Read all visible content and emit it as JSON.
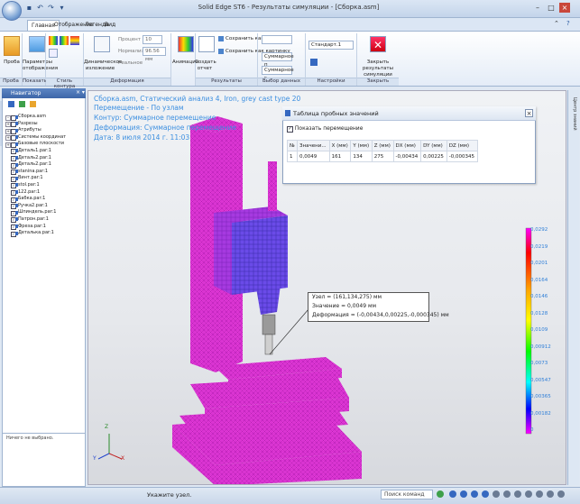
{
  "titlebar": {
    "title": "Solid Edge ST6 - Результаты симуляции - [Сборка.asm]",
    "help": "?"
  },
  "tabs": [
    {
      "label": "Главная",
      "active": true
    },
    {
      "label": "Отображение",
      "active": false
    },
    {
      "label": "Легенда",
      "active": false
    },
    {
      "label": "Вид",
      "active": false
    }
  ],
  "ribbon": {
    "proba": "Проба",
    "params": "Параметры отображения",
    "dynamic": "Динамическое изложение",
    "percent_label": "Процент",
    "percent_value": "10",
    "normalize_label": "Нормализовать",
    "normalize_value": "96.56 мм",
    "real_label": "Реальное",
    "animation": "Анимация",
    "create_report": "Создать отчет",
    "save_as_video": "Сохранить как видео",
    "save_as_image": "Сохранить как картинку",
    "data_select": "Суммарное п",
    "data_select2": "Суммарное г",
    "standard_select": "Стандарт.1",
    "close_results": "Закрыть результаты симуляции",
    "groups": {
      "proba": "Проба",
      "show": "Показать",
      "contour_style": "Стиль контура",
      "deformation": "Деформация",
      "results": "Результаты",
      "data_select": "Выбор данных",
      "settings": "Настройки",
      "close": "Закрыть"
    }
  },
  "navigator": {
    "title": "Навигатор",
    "items": [
      {
        "label": "Сборка.asm",
        "check": "",
        "exp": "–"
      },
      {
        "label": "Разрезы",
        "check": "",
        "exp": "+"
      },
      {
        "label": "Атрибуты",
        "check": "",
        "exp": "+"
      },
      {
        "label": "Системы координат",
        "check": "",
        "exp": "+"
      },
      {
        "label": "Базовые плоскости",
        "check": "",
        "exp": "+"
      },
      {
        "label": "Деталь1.par:1",
        "check": "✓",
        "exp": ""
      },
      {
        "label": "Деталь2.par:1",
        "check": "✓",
        "exp": ""
      },
      {
        "label": "Деталь2.par:1",
        "check": "✓",
        "exp": ""
      },
      {
        "label": "stanina.par:1",
        "check": "✓",
        "exp": ""
      },
      {
        "label": "Винт.par:1",
        "check": "✓",
        "exp": ""
      },
      {
        "label": "stol.par:1",
        "check": "✓",
        "exp": ""
      },
      {
        "label": "122.par:1",
        "check": "✓",
        "exp": ""
      },
      {
        "label": "Бабка.par:1",
        "check": "✓",
        "exp": ""
      },
      {
        "label": "Ручка2.par:1",
        "check": "✓",
        "exp": ""
      },
      {
        "label": "Шпиндель.par:1",
        "check": "✓",
        "exp": ""
      },
      {
        "label": "Патрон.par:1",
        "check": "✓",
        "exp": ""
      },
      {
        "label": "Фреза.par:1",
        "check": "✓",
        "exp": ""
      },
      {
        "label": "Деталька.par:1",
        "check": "✓",
        "exp": ""
      }
    ],
    "bottom_text": "Ничего не выбрано."
  },
  "viewport": {
    "lines": [
      "Сборка.asm, Статический анализ 4, Iron, grey cast type 20",
      "Перемещение - По узлам",
      "Контур: Суммарное перемещение",
      "Деформация: Суммарное перемещение",
      "Дата: 8 июля 2014 г. 11:03"
    ],
    "axis_x": "X",
    "axis_y": "Y",
    "axis_z": "Z"
  },
  "probe": {
    "title": "Таблица пробных значений",
    "show_move": "Показать перемещение",
    "headers": [
      "№",
      "Значени...",
      "X (мм)",
      "Y (мм)",
      "Z (мм)",
      "DX (мм)",
      "DY (мм)",
      "DZ (мм)"
    ],
    "row": [
      "1",
      "0,0049",
      "161",
      "134",
      "275",
      "-0,00434",
      "0,00225",
      "-0,000345"
    ]
  },
  "callout": {
    "node": "Узел = (161,134,275) мм",
    "value": "Значение = 0,0049 мм",
    "deform": "Деформация = (-0,00434,0,00225,-0,000345) мм"
  },
  "legend": {
    "ticks": [
      "0,0292",
      "0,0219",
      "0,0201",
      "0,0164",
      "0,0146",
      "0,0128",
      "0,0109",
      "0,00912",
      "0,0073",
      "0,00547",
      "0,00365",
      "0,00182",
      "0"
    ]
  },
  "right_strip": {
    "label": "Центр знаний"
  },
  "status": {
    "text": "Укажите узел.",
    "search": "Поиск команд"
  }
}
